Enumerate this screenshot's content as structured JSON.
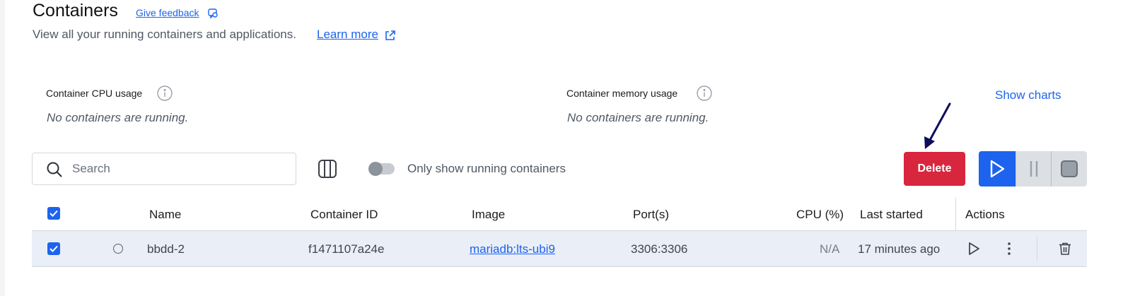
{
  "header": {
    "title": "Containers",
    "feedback_label": "Give feedback",
    "subtitle": "View all your running containers and applications.",
    "learn_more_label": "Learn more"
  },
  "stats": {
    "cpu_label": "Container CPU usage",
    "cpu_empty": "No containers are running.",
    "memory_label": "Container memory usage",
    "memory_empty": "No containers are running.",
    "show_charts_label": "Show charts"
  },
  "toolbar": {
    "search_placeholder": "Search",
    "search_value": "",
    "toggle_label": "Only show running containers",
    "toggle_on": false,
    "delete_label": "Delete"
  },
  "table": {
    "columns": {
      "name": "Name",
      "container_id": "Container ID",
      "image": "Image",
      "ports": "Port(s)",
      "cpu": "CPU (%)",
      "last_started": "Last started",
      "actions": "Actions"
    },
    "rows": [
      {
        "selected": true,
        "name": "bbdd-2",
        "container_id": "f1471107a24e",
        "image": "mariadb:lts-ubi9",
        "ports": "3306:3306",
        "cpu": "N/A",
        "last_started": "17 minutes ago"
      }
    ]
  },
  "icons": {
    "feedback": "feedback-icon",
    "external_link": "external-link-icon",
    "info": "info-icon",
    "search": "search-icon",
    "columns": "columns-icon",
    "play": "play-icon",
    "pause": "pause-icon",
    "stop": "stop-icon",
    "kebab": "more-vertical-icon",
    "trash": "trash-icon",
    "annotation_arrow": "arrow-icon"
  },
  "colors": {
    "accent": "#1d63ed",
    "danger": "#d7263d",
    "row_selected": "#e9eef7",
    "annotation": "#0d0d5c"
  }
}
